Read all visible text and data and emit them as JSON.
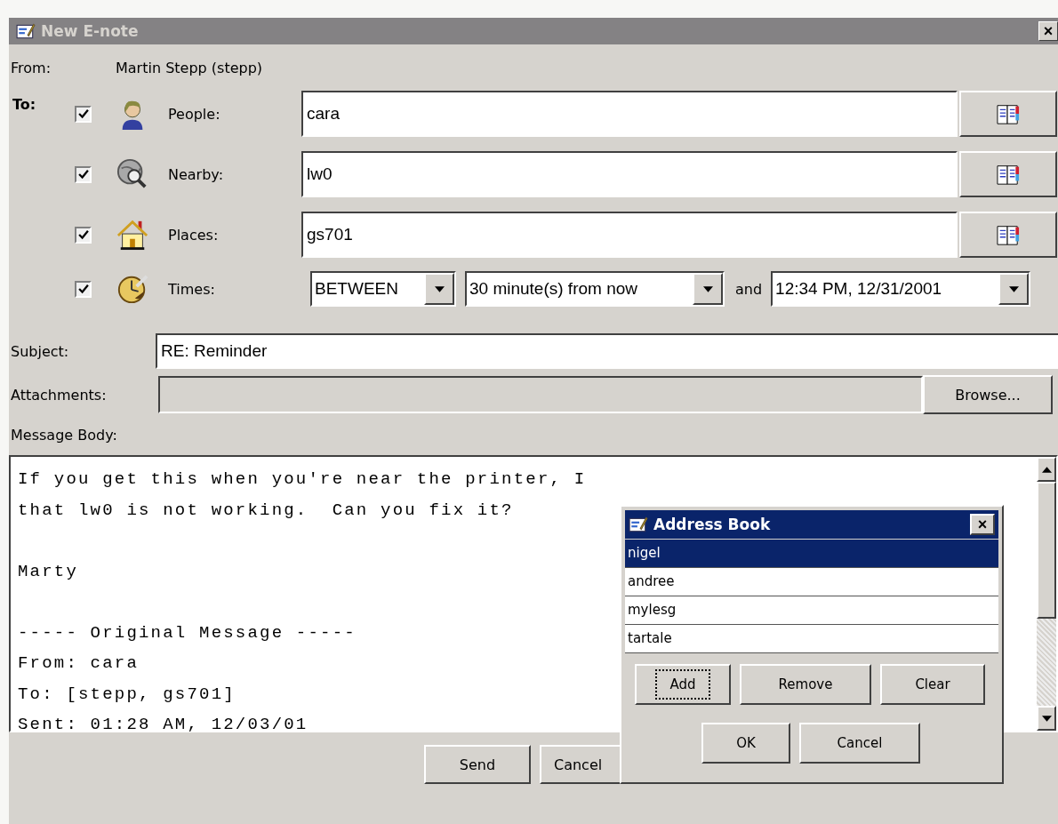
{
  "window": {
    "title": "New E-note",
    "close": "×"
  },
  "from": {
    "label": "From:",
    "value": "Martin Stepp (stepp)"
  },
  "to": {
    "label": "To:",
    "recipients": [
      {
        "kind": "people",
        "checked": true,
        "label": "People:",
        "value": "cara"
      },
      {
        "kind": "nearby",
        "checked": true,
        "label": "Nearby:",
        "value": "lw0"
      },
      {
        "kind": "places",
        "checked": true,
        "label": "Places:",
        "value": "gs701"
      },
      {
        "kind": "times",
        "checked": true,
        "label": "Times:",
        "mode": "BETWEEN",
        "start": "30 minute(s) from now",
        "joiner": "and",
        "end": "12:34 PM, 12/31/2001"
      }
    ]
  },
  "subject": {
    "label": "Subject:",
    "value": "RE: Reminder"
  },
  "attachments": {
    "label": "Attachments:",
    "button": "Browse..."
  },
  "body": {
    "label": "Message Body:",
    "paragraphs": [
      [
        "If you get this when you're near the printer, I",
        "that lw0 is not working.  Can you fix it?"
      ],
      [
        "Marty"
      ],
      [
        "----- Original Message -----",
        "From: cara",
        "To: [stepp, gs701]",
        "Sent: 01:28 AM, 12/03/01"
      ]
    ]
  },
  "buttons": [
    "Send",
    "Cancel"
  ],
  "dialog": {
    "title": "Address Book",
    "close": "×",
    "items": [
      {
        "name": "nigel",
        "selected": true
      },
      {
        "name": "andree",
        "selected": false
      },
      {
        "name": "mylesg",
        "selected": false
      },
      {
        "name": "tartale",
        "selected": false
      }
    ],
    "actions": [
      {
        "label": "Add",
        "focused": true
      },
      {
        "label": "Remove",
        "focused": false
      },
      {
        "label": "Clear",
        "focused": false
      }
    ],
    "buttons": [
      {
        "label": "OK",
        "focused": false
      },
      {
        "label": "Cancel",
        "focused": false
      }
    ]
  }
}
